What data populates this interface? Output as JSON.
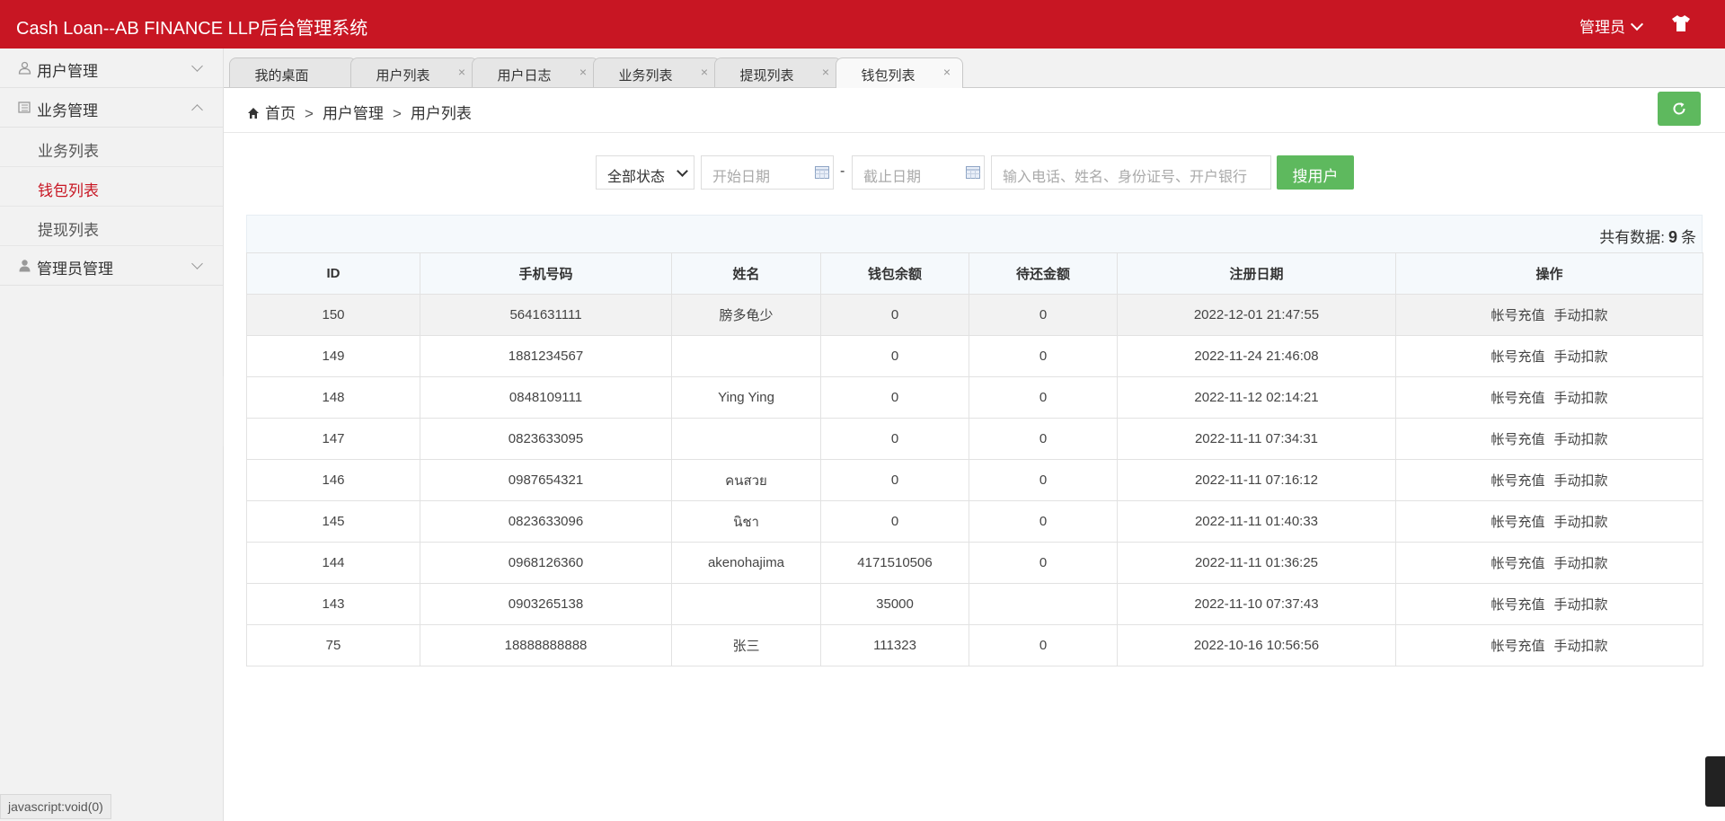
{
  "header": {
    "title": "Cash Loan--AB FINANCE LLP后台管理系统",
    "admin_label": "管理员",
    "skin_icon": "shirt-icon",
    "colors": {
      "brand": "#c81623",
      "accent_green": "#5eb95e"
    }
  },
  "sidebar": {
    "groups": [
      {
        "label": "用户管理",
        "icon": "user-icon",
        "expanded": false
      },
      {
        "label": "业务管理",
        "icon": "list-icon",
        "expanded": true,
        "items": [
          {
            "label": "业务列表",
            "active": false
          },
          {
            "label": "钱包列表",
            "active": true
          },
          {
            "label": "提现列表",
            "active": false
          }
        ]
      },
      {
        "label": "管理员管理",
        "icon": "admin-icon",
        "expanded": false
      }
    ]
  },
  "tabs": [
    {
      "label": "我的桌面",
      "closable": false
    },
    {
      "label": "用户列表",
      "closable": true
    },
    {
      "label": "用户日志",
      "closable": true
    },
    {
      "label": "业务列表",
      "closable": true
    },
    {
      "label": "提现列表",
      "closable": true
    },
    {
      "label": "钱包列表",
      "closable": true,
      "active": true
    }
  ],
  "close_glyph": "×",
  "breadcrumb": {
    "home": "首页",
    "sep": ">",
    "level1": "用户管理",
    "level2": "用户列表"
  },
  "filters": {
    "status_select": "全部状态",
    "date_separator": "-",
    "start_date_placeholder": "开始日期",
    "end_date_placeholder": "截止日期",
    "search_placeholder": "输入电话、姓名、身份证号、开户银行",
    "search_button": "搜用户"
  },
  "summary": {
    "prefix": "共有数据:",
    "count": "9",
    "suffix": "条"
  },
  "table": {
    "columns": [
      "ID",
      "手机号码",
      "姓名",
      "钱包余额",
      "待还金额",
      "注册日期",
      "操作"
    ],
    "action_labels": [
      "帐号充值",
      "手动扣款"
    ],
    "rows": [
      {
        "id": "150",
        "phone": "5641631111",
        "name": "膀多龟少",
        "balance": "0",
        "due": "0",
        "date": "2022-12-01 21:47:55"
      },
      {
        "id": "149",
        "phone": "1881234567",
        "name": "",
        "balance": "0",
        "due": "0",
        "date": "2022-11-24 21:46:08"
      },
      {
        "id": "148",
        "phone": "0848109111",
        "name": "Ying Ying",
        "balance": "0",
        "due": "0",
        "date": "2022-11-12 02:14:21"
      },
      {
        "id": "147",
        "phone": "0823633095",
        "name": "",
        "balance": "0",
        "due": "0",
        "date": "2022-11-11 07:34:31"
      },
      {
        "id": "146",
        "phone": "0987654321",
        "name": "คนสวย",
        "balance": "0",
        "due": "0",
        "date": "2022-11-11 07:16:12"
      },
      {
        "id": "145",
        "phone": "0823633096",
        "name": "นิชา",
        "balance": "0",
        "due": "0",
        "date": "2022-11-11 01:40:33"
      },
      {
        "id": "144",
        "phone": "0968126360",
        "name": "akenohajima",
        "balance": "4171510506",
        "due": "0",
        "date": "2022-11-11 01:36:25"
      },
      {
        "id": "143",
        "phone": "0903265138",
        "name": "",
        "balance": "35000",
        "due": "",
        "date": "2022-11-10 07:37:43"
      },
      {
        "id": "75",
        "phone": "18888888888",
        "name": "张三",
        "balance": "111323",
        "due": "0",
        "date": "2022-10-16 10:56:56"
      }
    ]
  },
  "status_bar": "javascript:void(0)"
}
